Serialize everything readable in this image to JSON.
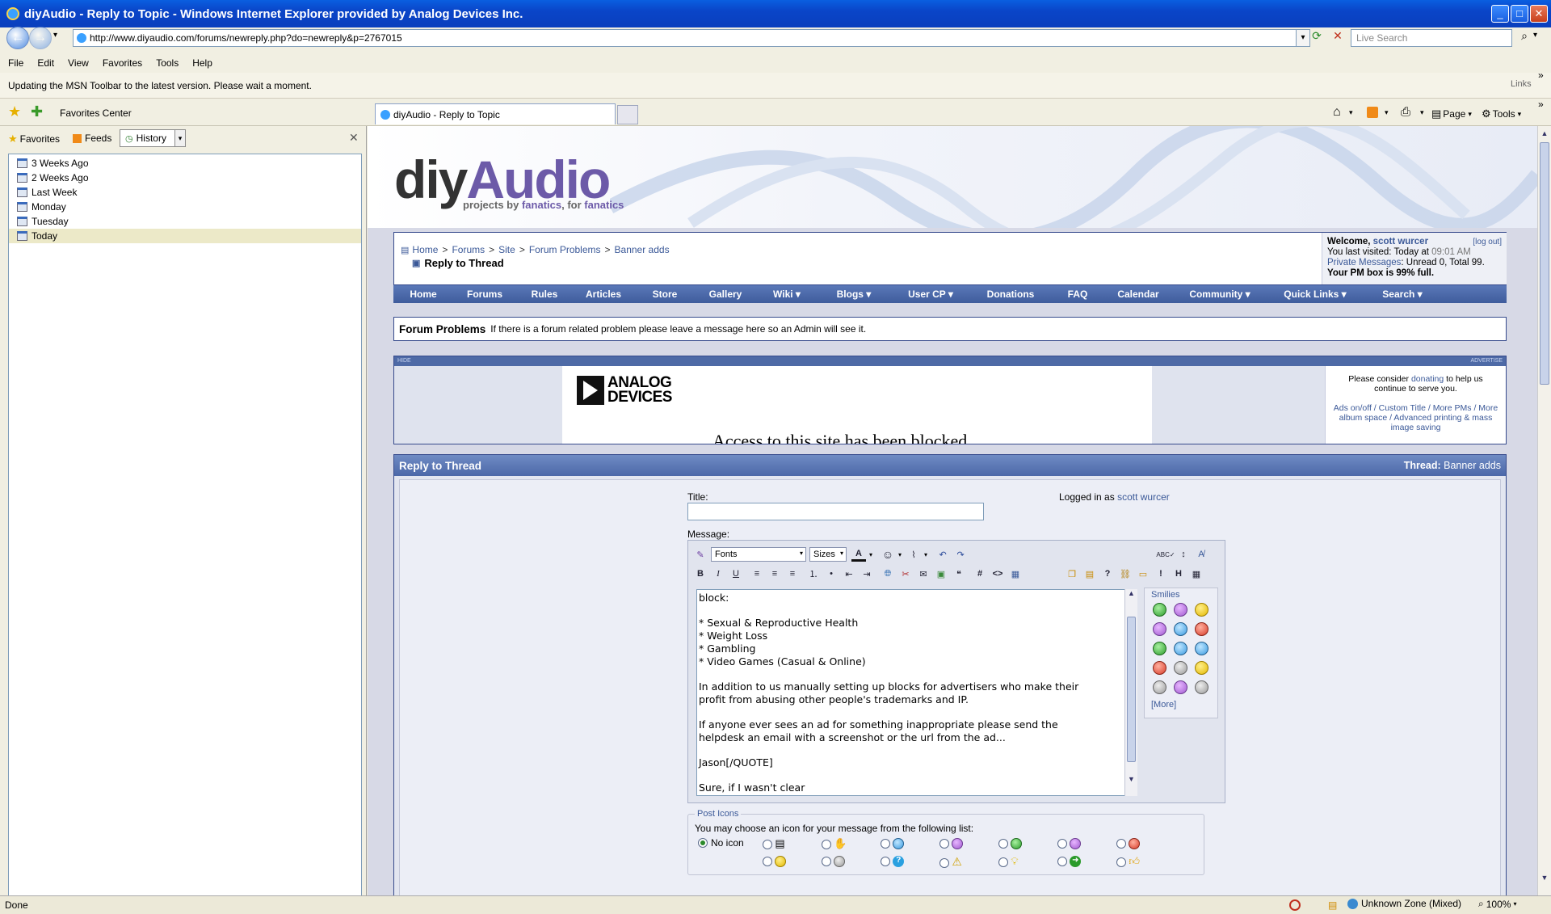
{
  "window": {
    "title": "diyAudio - Reply to Topic - Windows Internet Explorer provided by Analog Devices Inc."
  },
  "browser": {
    "address": "http://www.diyaudio.com/forums/newreply.php?do=newreply&p=2767015",
    "search_placeholder": "Live Search",
    "menu": [
      "File",
      "Edit",
      "View",
      "Favorites",
      "Tools",
      "Help"
    ],
    "msn_message": "Updating the MSN Toolbar to the latest version.  Please wait a moment.",
    "links_label": "Links",
    "favorites_center_label": "Favorites Center",
    "tab_title": "diyAudio - Reply to Topic",
    "page_label": "Page",
    "tools_label": "Tools"
  },
  "sidebar": {
    "tabs": {
      "favorites": "Favorites",
      "feeds": "Feeds",
      "history": "History"
    },
    "history_items": [
      {
        "label": "3 Weeks Ago"
      },
      {
        "label": "2 Weeks Ago"
      },
      {
        "label": "Last Week"
      },
      {
        "label": "Monday"
      },
      {
        "label": "Tuesday"
      },
      {
        "label": "Today"
      }
    ]
  },
  "site": {
    "logo_left": "diy",
    "logo_right": "Audio",
    "tagline_1": "projects by ",
    "tagline_2": "fanatics",
    "tagline_3": ", for ",
    "tagline_4": "fanatics",
    "breadcrumb": [
      "Home",
      "Forums",
      "Site",
      "Forum Problems",
      "Banner adds"
    ],
    "breadcrumb_sep": ">",
    "page_title": "Reply to Thread",
    "welcome": {
      "welcome_label": "Welcome, ",
      "username": "scott wurcer",
      "logout": "[log out]",
      "last_visited_label": "You last visited: Today at ",
      "last_visited_time": "09:01 AM",
      "pm_label": "Private Messages",
      "pm_stats": ": Unread 0, Total 99.",
      "pm_full": "Your PM box is 99% full."
    },
    "nav": [
      "Home",
      "Forums",
      "Rules",
      "Articles",
      "Store",
      "Gallery",
      "Wiki ▾",
      "Blogs ▾",
      "User CP ▾",
      "Donations",
      "FAQ",
      "Calendar",
      "Community ▾",
      "Quick Links ▾",
      "Search ▾"
    ],
    "forum_box": {
      "name": "Forum Problems",
      "desc": "If there is a forum related problem please leave a message here so an Admin will see it."
    },
    "ad": {
      "hide": "HIDE",
      "advertise": "ADVERTISE",
      "brand_1": "ANALOG",
      "brand_2": "DEVICES",
      "blocked_text": "Access to this site has been blocked",
      "consider_1": "Please consider ",
      "consider_link": "donating",
      "consider_2": " to help us continue to serve you.",
      "perks": "Ads on/off / Custom Title / More PMs / More album space / Advanced printing & mass image saving"
    },
    "reply": {
      "header": "Reply to Thread",
      "thread_label": "Thread:",
      "thread_name": "Banner adds",
      "title_label": "Title:",
      "title_value": "",
      "logged_in_label": "Logged in as ",
      "logged_in_user": "scott wurcer",
      "message_label": "Message:",
      "fonts": "Fonts",
      "sizes": "Sizes",
      "message_lines": [
        "block:",
        "",
        "* Sexual & Reproductive Health",
        "* Weight Loss",
        "* Gambling",
        "* Video Games (Casual & Online)",
        "",
        "In addition to us manually setting up blocks for advertisers who make their",
        "profit from abusing other people's trademarks and IP.",
        "",
        "If anyone ever sees an ad for something inappropriate please send the",
        "helpdesk an email with a screenshot or the url from the ad...",
        "",
        "Jason[/QUOTE]",
        "",
        "Sure, if I wasn't clear"
      ],
      "smilies_label": "Smilies",
      "smilies_more": "[More]",
      "post_icons_legend": "Post Icons",
      "post_icons_desc": "You may choose an icon for your message from the following list:",
      "no_icon": "No icon"
    }
  },
  "status": {
    "text": "Done",
    "zone": "Unknown Zone (Mixed)",
    "zoom": "100%"
  },
  "colors": {
    "accent": "#3b5998",
    "nav": "#3f5c9c",
    "logo_purple": "#6c5aa8"
  }
}
